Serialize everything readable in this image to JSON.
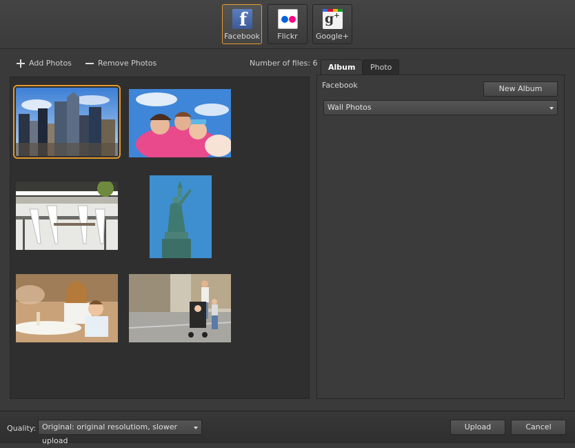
{
  "services": [
    {
      "label": "Facebook",
      "icon": "facebook-icon",
      "active": true
    },
    {
      "label": "Flickr",
      "icon": "flickr-icon",
      "active": false
    },
    {
      "label": "Google+",
      "icon": "google-plus-icon",
      "active": false
    }
  ],
  "toolbar": {
    "add_label": "Add Photos",
    "remove_label": "Remove Photos",
    "file_count": "Number of files: 6"
  },
  "photos": [
    {
      "name": "city-skyline",
      "selected": true
    },
    {
      "name": "family-sky",
      "selected": false
    },
    {
      "name": "cafe-chairs",
      "selected": false
    },
    {
      "name": "statue-of-liberty",
      "selected": false
    },
    {
      "name": "mother-son-cafe",
      "selected": false
    },
    {
      "name": "family-stroller-street",
      "selected": false
    }
  ],
  "tabs": [
    {
      "label": "Album",
      "active": true
    },
    {
      "label": "Photo",
      "active": false
    }
  ],
  "album": {
    "service_label": "Facebook",
    "new_album_label": "New Album",
    "selected_album": "Wall Photos"
  },
  "footer": {
    "quality_label": "Quality:",
    "quality_value": "Original: original resolutiom, slower upload",
    "upload_label": "Upload",
    "cancel_label": "Cancel"
  },
  "colors": {
    "accent": "#e79a30",
    "background": "#3a3a3a",
    "panel": "#2f2f2f"
  }
}
